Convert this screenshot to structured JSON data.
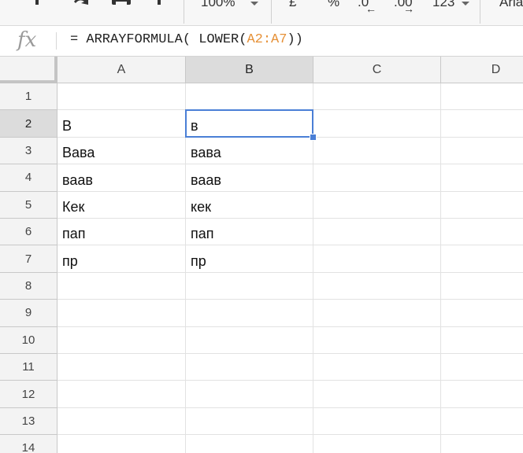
{
  "toolbar": {
    "zoom": "100%",
    "currency": "£",
    "percent": "%",
    "decrease_decimals": ".0",
    "increase_decimals": ".00",
    "more_formats": "123",
    "font": "Aria"
  },
  "formula_bar": {
    "fx_label": "fx",
    "prefix": "= ARRAYFORMULA( LOWER(",
    "range": "A2:A7",
    "suffix": "))"
  },
  "columns": [
    "A",
    "B",
    "C",
    "D"
  ],
  "rows": [
    "1",
    "2",
    "3",
    "4",
    "5",
    "6",
    "7",
    "8",
    "9",
    "10",
    "11",
    "12",
    "13",
    "14"
  ],
  "cells": {
    "A2": "В",
    "A3": "Вава",
    "A4": "ваав",
    "A5": "Кек",
    "A6": "пап",
    "A7": "пр",
    "B2": "в",
    "B3": "вава",
    "B4": "ваав",
    "B5": "кек",
    "B6": "пап",
    "B7": "пр"
  },
  "selection": {
    "cell": "B2",
    "color": "#4a7fd6"
  },
  "icons": [
    "paint-format-icon",
    "redo-icon",
    "print-icon",
    "format-icon"
  ]
}
